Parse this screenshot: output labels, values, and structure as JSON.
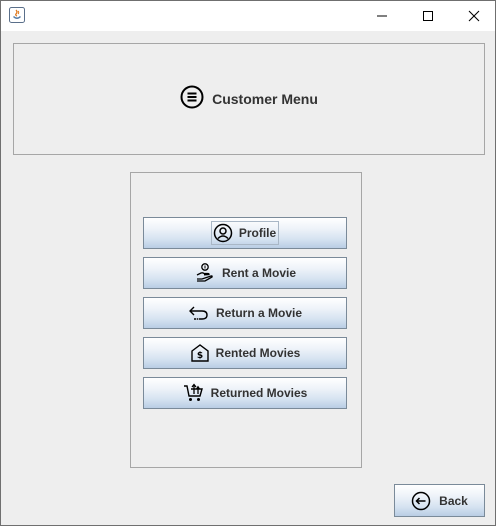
{
  "window": {
    "app_icon": "java-cup-icon",
    "controls": [
      "minimize-icon",
      "maximize-icon",
      "close-icon"
    ]
  },
  "header": {
    "icon": "menu-circle-icon",
    "title": "Customer Menu"
  },
  "menu": {
    "items": [
      {
        "label": "Profile",
        "icon": "user-circle-icon"
      },
      {
        "label": "Rent a Movie",
        "icon": "hand-coin-icon"
      },
      {
        "label": "Return a Movie",
        "icon": "return-arrow-icon"
      },
      {
        "label": "Rented Movies",
        "icon": "house-dollar-icon"
      },
      {
        "label": "Returned Movies",
        "icon": "cart-upload-icon"
      }
    ]
  },
  "footer": {
    "back_label": "Back",
    "back_icon": "arrow-left-circle-icon"
  }
}
